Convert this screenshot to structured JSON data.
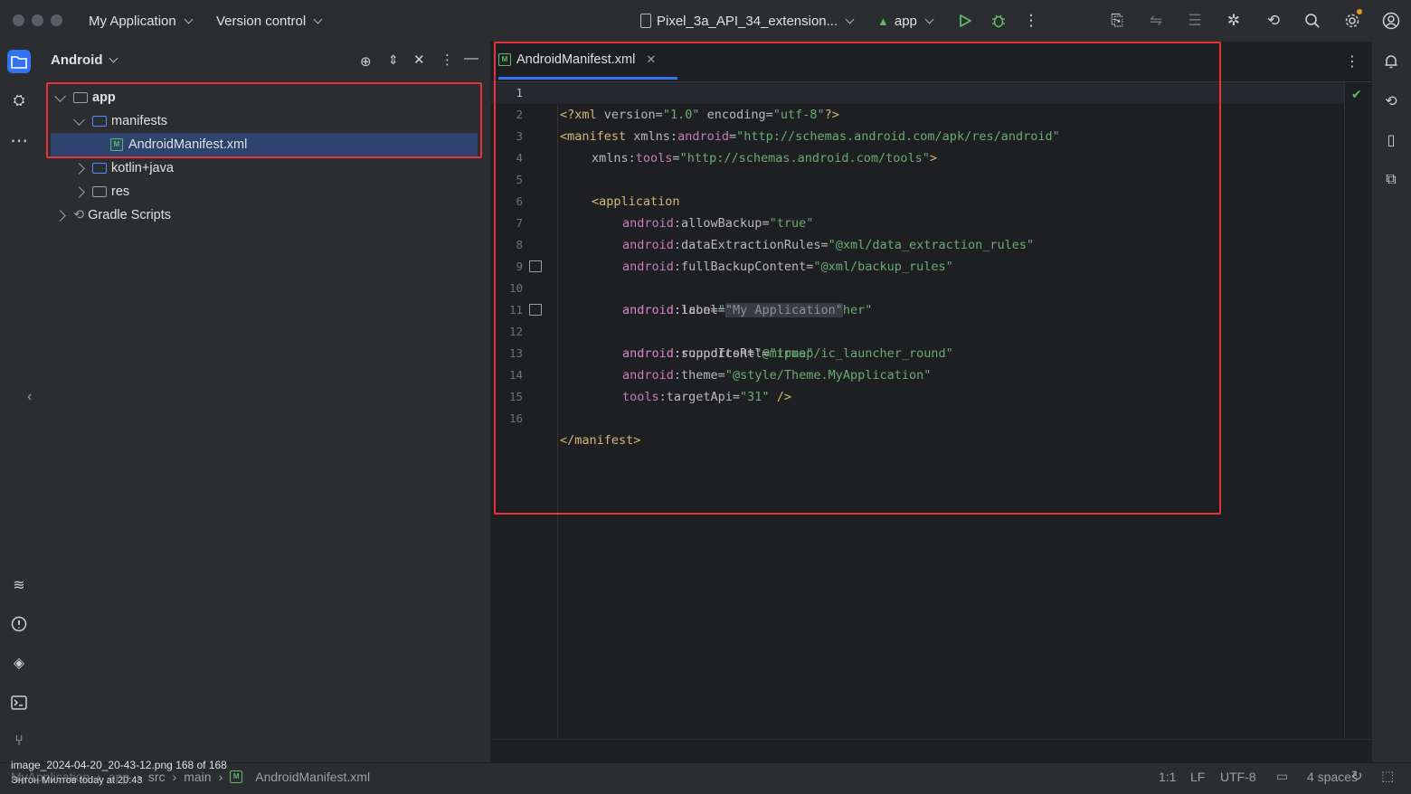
{
  "titlebar": {
    "project_name": "My Application",
    "vcs_label": "Version control",
    "device": "Pixel_3a_API_34_extension...",
    "run_config": "app"
  },
  "project_panel": {
    "view_mode": "Android",
    "tree": [
      {
        "label": "app",
        "expanded": true,
        "depth": 0
      },
      {
        "label": "manifests",
        "expanded": true,
        "depth": 1
      },
      {
        "label": "AndroidManifest.xml",
        "selected": true,
        "depth": 2
      },
      {
        "label": "kotlin+java",
        "expanded": false,
        "depth": 1
      },
      {
        "label": "res",
        "expanded": false,
        "depth": 1
      },
      {
        "label": "Gradle Scripts",
        "expanded": false,
        "depth": 0
      }
    ]
  },
  "editor": {
    "tab_label": "AndroidManifest.xml",
    "line_numbers": [
      "1",
      "2",
      "3",
      "4",
      "5",
      "6",
      "7",
      "8",
      "9",
      "10",
      "11",
      "12",
      "13",
      "14",
      "15",
      "16"
    ],
    "code": {
      "l1_open": "<?xml ",
      "l1_a1": "version=",
      "l1_v1": "\"1.0\"",
      "l1_a2": " encoding=",
      "l1_v2": "\"utf-8\"",
      "l1_close": "?>",
      "l2_tag": "<manifest ",
      "l2_attr": "xmlns:",
      "l2_ns": "android",
      "l2_eq": "=",
      "l2_val": "\"http://schemas.android.com/apk/res/android\"",
      "l3_attr": "xmlns:",
      "l3_ns": "tools",
      "l3_eq": "=",
      "l3_val": "\"http://schemas.android.com/tools\"",
      "l3_close": ">",
      "l5_tag": "<application",
      "l6_ns": "android",
      "l6_attr": ":allowBackup=",
      "l6_val": "\"true\"",
      "l7_ns": "android",
      "l7_attr": ":dataExtractionRules=",
      "l7_val": "\"@xml/data_extraction_rules\"",
      "l8_ns": "android",
      "l8_attr": ":fullBackupContent=",
      "l8_val": "\"@xml/backup_rules\"",
      "l9_ns": "android",
      "l9_attr": ":icon=",
      "l9_val": "\"@mipmap/ic_launcher\"",
      "l10_ns": "android",
      "l10_attr": ":label=",
      "l10_val": "\"My Application\"",
      "l11_ns": "android",
      "l11_attr": ":roundIcon=",
      "l11_val": "\"@mipmap/ic_launcher_round\"",
      "l12_ns": "android",
      "l12_attr": ":supportsRtl=",
      "l12_val": "\"true\"",
      "l13_ns": "android",
      "l13_attr": ":theme=",
      "l13_val": "\"@style/Theme.MyApplication\"",
      "l14_ns": "tools",
      "l14_attr": ":targetApi=",
      "l14_val": "\"31\"",
      "l14_close": " />",
      "l16_tag": "</manifest>"
    }
  },
  "statusbar": {
    "overlay_filename": "image_2024-04-20_20-43-12.png 168 of 168",
    "overlay_author": "Энтон Милтов  today at 20:43",
    "breadcrumb": [
      "MyApplication",
      "app",
      "src",
      "main",
      "AndroidManifest.xml"
    ],
    "position": "1:1",
    "line_sep": "LF",
    "encoding": "UTF-8",
    "indent": "4 spaces"
  },
  "colors": {
    "accent": "#3574f0",
    "highlight_box": "#e5333a",
    "tag": "#d5b778",
    "namespace": "#c77dbb",
    "string": "#6aab73"
  }
}
